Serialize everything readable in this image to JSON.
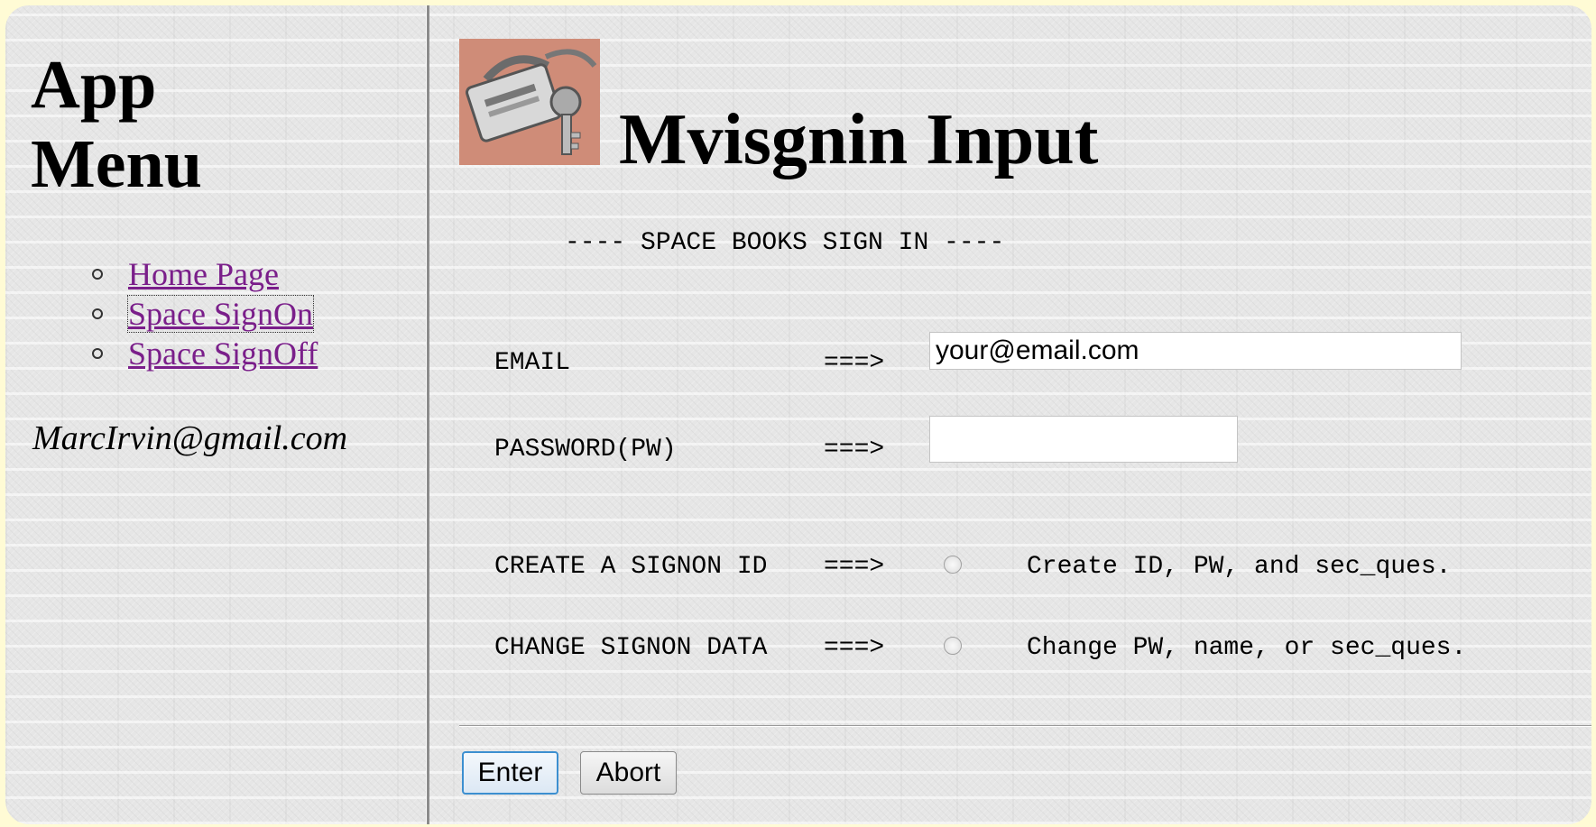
{
  "sidebar": {
    "title_line1": "App",
    "title_line2": "Menu",
    "menu": [
      {
        "label": "Home Page"
      },
      {
        "label": "Space SignOn"
      },
      {
        "label": "Space SignOff"
      }
    ],
    "user_email": "MarcIrvin@gmail.com"
  },
  "main": {
    "logo_icon": "padlock-key-icon",
    "title": "Mvisgnin Input",
    "subtitle": "---- SPACE BOOKS SIGN IN ----",
    "email": {
      "label": "EMAIL",
      "arrow": "===>",
      "value": "your@email.com"
    },
    "password": {
      "label": "PASSWORD(PW)",
      "arrow": "===>",
      "value": ""
    },
    "create": {
      "label": "CREATE A SIGNON ID",
      "arrow": "===>",
      "description": "Create ID, PW, and sec_ques."
    },
    "change": {
      "label": "CHANGE SIGNON DATA",
      "arrow": "===>",
      "description": "Change PW, name, or sec_ques."
    },
    "buttons": {
      "enter": "Enter",
      "abort": "Abort"
    }
  },
  "colors": {
    "page_border": "#fffbd5",
    "link": "#7a1e8a",
    "enter_border": "#3c8fd0"
  }
}
